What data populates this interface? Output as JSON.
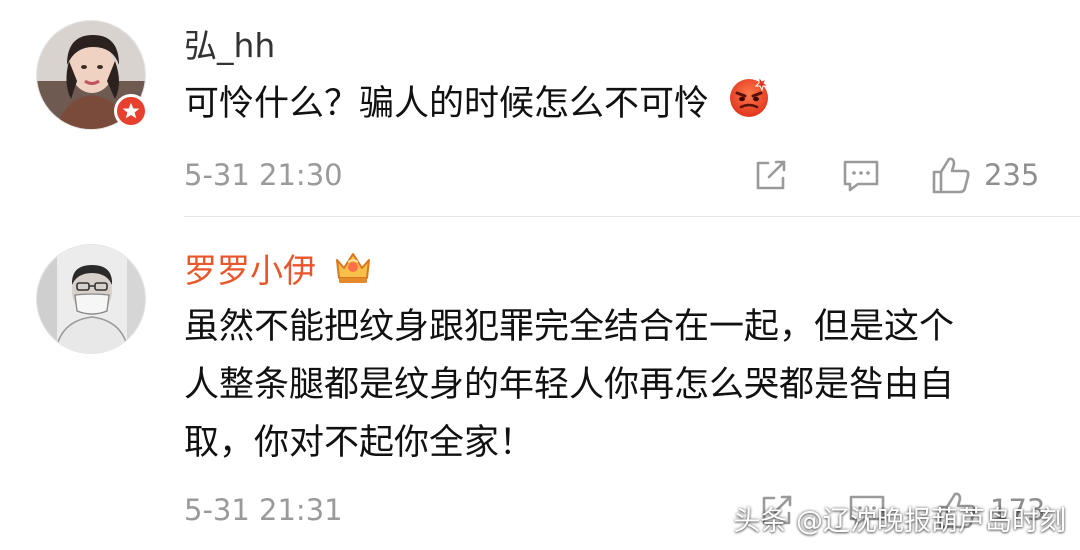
{
  "colors": {
    "text": "#111111",
    "meta": "#9a9a9a",
    "vip_name": "#e8562a",
    "badge_red": "#e8402e",
    "crown_gold": "#f2a33a"
  },
  "comments": [
    {
      "username": "弘_hh",
      "text_lines": [
        "可怜什么？骗人的时候怎么不可怜"
      ],
      "emoji": "angry-face-emoji",
      "time": "5-31 21:30",
      "likes": "235",
      "username_color": "#333333"
    },
    {
      "username": "罗罗小伊",
      "text_lines": [
        "虽然不能把纹身跟犯罪完全结合在一起，但是这个",
        "人整条腿都是纹身的年轻人你再怎么哭都是咎由自",
        "取，你对不起你全家！"
      ],
      "time": "5-31 21:31",
      "likes": "173",
      "username_color": "#e8562a"
    }
  ],
  "watermark": "头条 @辽沈晚报葫芦岛时刻"
}
